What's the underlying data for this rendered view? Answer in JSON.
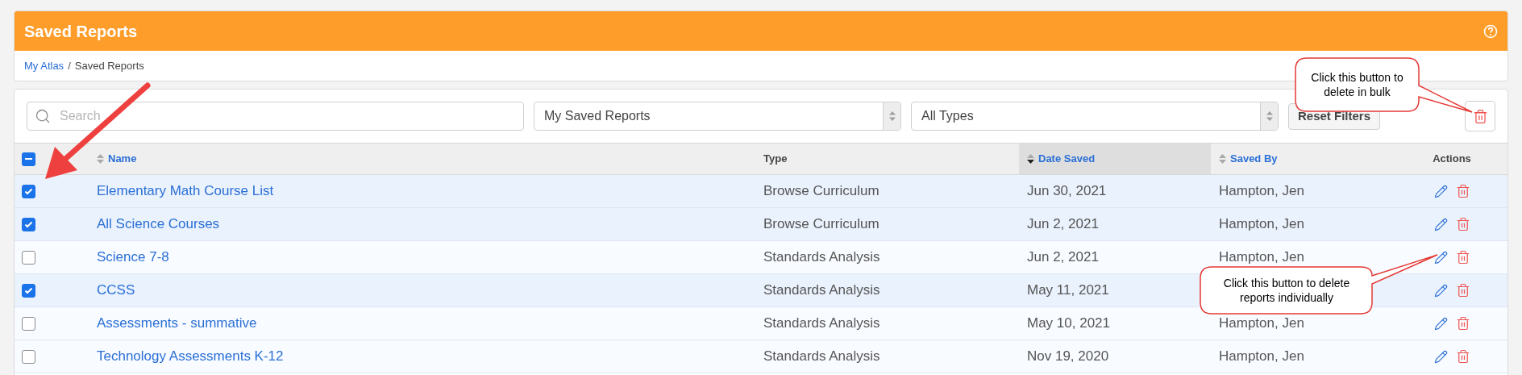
{
  "header": {
    "title": "Saved Reports"
  },
  "breadcrumb": {
    "separator": "/",
    "items": [
      {
        "label": "My Atlas",
        "kind": "link"
      },
      {
        "label": "Saved Reports",
        "kind": "current"
      }
    ]
  },
  "filters": {
    "search": {
      "placeholder": "Search"
    },
    "selects": [
      {
        "value": "My Saved Reports"
      },
      {
        "value": "All Types"
      }
    ],
    "reset_button": "Reset Filters"
  },
  "table": {
    "select_all": {
      "indeterminate": true
    },
    "columns": [
      {
        "label": "Name",
        "sortable": true,
        "sorted": false
      },
      {
        "label": "Type",
        "sortable": false,
        "sorted": false
      },
      {
        "label": "Date Saved",
        "sortable": true,
        "sorted": true
      },
      {
        "label": "Saved By",
        "sortable": true,
        "sorted": false
      },
      {
        "label": "Actions",
        "sortable": false,
        "sorted": false
      }
    ],
    "rows": [
      {
        "name": "Elementary Math Course List",
        "type": "Browse Curriculum",
        "date_saved": "Jun 30, 2021",
        "saved_by": "Hampton, Jen",
        "selected": true
      },
      {
        "name": "All Science Courses",
        "type": "Browse Curriculum",
        "date_saved": "Jun 2, 2021",
        "saved_by": "Hampton, Jen",
        "selected": true
      },
      {
        "name": "Science 7-8",
        "type": "Standards Analysis",
        "date_saved": "Jun 2, 2021",
        "saved_by": "Hampton, Jen",
        "selected": false
      },
      {
        "name": "CCSS",
        "type": "Standards Analysis",
        "date_saved": "May 11, 2021",
        "selected": true
      },
      {
        "name": "Assessments - summative",
        "type": "Standards Analysis",
        "date_saved": "May 10, 2021",
        "saved_by": "Hampton, Jen",
        "selected": false
      },
      {
        "name": "Technology Assessments K-12",
        "type": "Standards Analysis",
        "date_saved": "Nov 19, 2020",
        "saved_by": "Hampton, Jen",
        "selected": false
      }
    ]
  },
  "annotations": [
    {
      "kind": "callout_bulk",
      "text": "Click this button to delete in bulk"
    },
    {
      "kind": "callout_row",
      "text": "Click this button to delete reports individually"
    },
    {
      "kind": "arrow"
    }
  ]
}
